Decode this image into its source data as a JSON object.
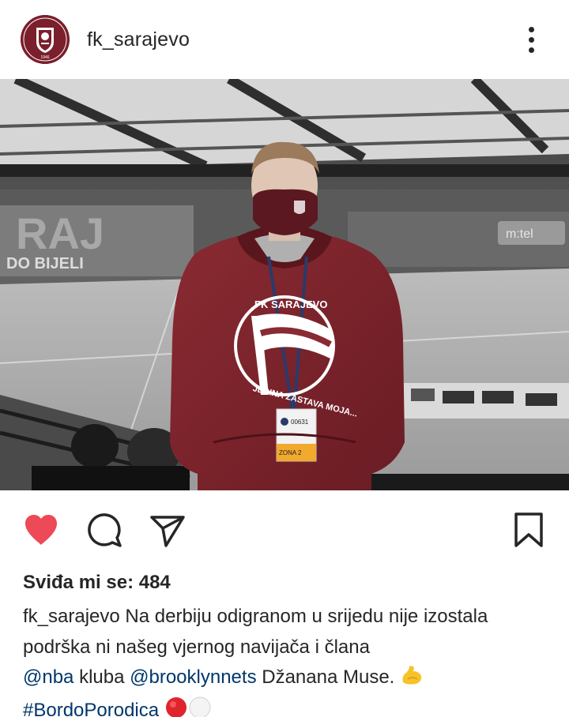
{
  "post": {
    "username": "fk_sarajevo",
    "avatar_icon": "fk-sarajevo-crest-icon",
    "more_icon": "more-vertical-icon"
  },
  "photo": {
    "mask_logo": "fk-sarajevo-crest-icon",
    "hoodie_text_top": "FK SARAJEVO",
    "hoodie_text_bottom": "JEDINA ZASTAVA MOJA...",
    "badge_number": "00631",
    "badge_zone": "ZONA 2",
    "stand_letters": "RAJ",
    "stand_bottom": "DO BIJELI",
    "ad_text": "m:tel"
  },
  "actions": {
    "like_icon": "heart-filled-icon",
    "comment_icon": "comment-icon",
    "share_icon": "send-icon",
    "save_icon": "bookmark-icon",
    "like_color": "#ed4956"
  },
  "likes": {
    "label": "Sviđa mi se:",
    "count": "484"
  },
  "caption": {
    "username": "fk_sarajevo",
    "text_1": "Na derbiju odigranom u srijedu nije izostala podrška ni našeg vjernog navijača i člana",
    "mention_nba": "@nba",
    "text_2": "kluba",
    "mention_nets": "@brooklynnets",
    "text_3": "Džanana Muse.",
    "hashtag": "#BordoPorodica",
    "emoji_1": "muscle-emoji",
    "emoji_2": "red-circle-emoji",
    "emoji_3": "white-circle-emoji"
  },
  "colors": {
    "maroon": "#7a1f2b",
    "link": "#00376b",
    "text": "#262626"
  }
}
